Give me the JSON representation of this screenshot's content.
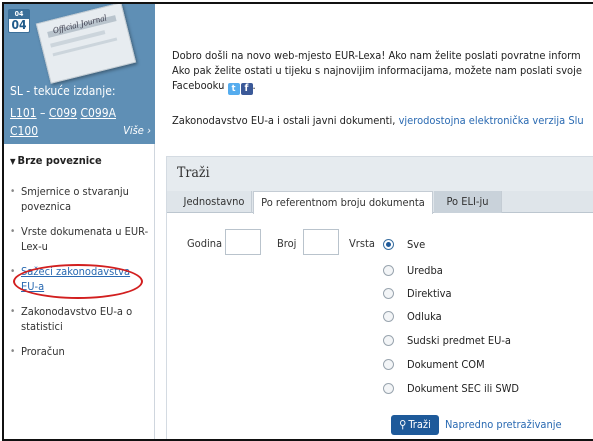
{
  "oj": {
    "cal_top": "04",
    "cal_num": "04",
    "cover_title": "Official Journal",
    "label": "SL - tekuće izdanje:",
    "links": [
      "L101",
      "C099",
      "C099A",
      "C100"
    ],
    "more": "Više ›"
  },
  "quick_links": {
    "title": "Brze poveznice",
    "items": [
      "Smjernice o stvaranju poveznica",
      "Vrste dokumenata u EUR-Lex-u",
      "Sažeci zakonodavstva EU-a",
      "Zakonodavstvo EU-a o statistici",
      "Proračun"
    ]
  },
  "welcome": {
    "line1": "Dobro došli na novo web-mjesto EUR-Lexa! Ako nam želite poslati povratne inform",
    "line2": "Ako pak želite ostati u tijeku s najnovijim informacijama, možete nam poslati svoje",
    "line3": "Facebooku",
    "line3_end": ".",
    "twitter_icon": "twitter-icon",
    "facebook_icon": "facebook-icon"
  },
  "legislation": {
    "text": "Zakonodavstvo EU-a i ostali javni dokumenti, ",
    "link": "vjerodostojna elektronička verzija Slu"
  },
  "search": {
    "title": "Traži",
    "tabs": [
      "Jednostavno",
      "Po referentnom broju dokumenta",
      "Po ELI-ju"
    ],
    "active_tab": 1,
    "year_label": "Godina",
    "number_label": "Broj",
    "type_label": "Vrsta",
    "types": [
      "Sve",
      "Uredba",
      "Direktiva",
      "Odluka",
      "Sudski predmet EU-a",
      "Dokument COM",
      "Dokument SEC ili SWD"
    ],
    "selected_type": "Sve",
    "button": "Traži",
    "advanced": "Napredno pretraživanje"
  },
  "colors": {
    "oj_panel": "#5f8fb5",
    "link": "#2a6ab2",
    "button": "#1e5a9a",
    "highlight_oval": "#d21f1f"
  }
}
